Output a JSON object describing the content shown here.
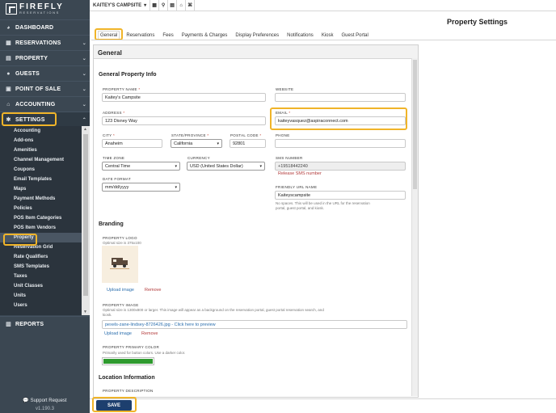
{
  "brand": {
    "name": "FIREFLY",
    "sub": "RESERVATIONS"
  },
  "sidebar": {
    "items": [
      {
        "label": "DASHBOARD",
        "icon": "dashboard-icon"
      },
      {
        "label": "RESERVATIONS",
        "icon": "calendar-icon"
      },
      {
        "label": "PROPERTY",
        "icon": "building-icon"
      },
      {
        "label": "GUESTS",
        "icon": "user-icon"
      },
      {
        "label": "POINT OF SALE",
        "icon": "register-icon"
      },
      {
        "label": "ACCOUNTING",
        "icon": "bank-icon"
      },
      {
        "label": "SETTINGS",
        "icon": "gear-icon"
      }
    ],
    "settings_sub": [
      "Accounting",
      "Add-ons",
      "Amenities",
      "Channel Management",
      "Coupons",
      "Email Templates",
      "Maps",
      "Payment Methods",
      "Policies",
      "POS Item Categories",
      "POS Item Vendors",
      "Property",
      "Reservation Grid",
      "Rate Qualifiers",
      "SMS Templates",
      "Taxes",
      "Unit Classes",
      "Units",
      "Users"
    ],
    "active_sub": "Property",
    "reports": "REPORTS",
    "support": "Support Request",
    "version": "v1.190.3"
  },
  "topbar": {
    "campsite": "KAITEY'S CAMPSITE"
  },
  "page": {
    "title": "Property Settings"
  },
  "tabs": [
    "General",
    "Reservations",
    "Fees",
    "Payments & Charges",
    "Display Preferences",
    "Notifications",
    "Kiosk",
    "Guest Portal"
  ],
  "active_tab": "General",
  "panel": {
    "title": "General",
    "info_title": "General Property Info",
    "property_name": {
      "label": "PROPERTY NAME",
      "value": "Kaitey's Campsite"
    },
    "website": {
      "label": "WEBSITE",
      "value": ""
    },
    "address": {
      "label": "ADDRESS",
      "value": "123 Disney Way"
    },
    "email": {
      "label": "EMAIL",
      "value": "kaiteyvasquez@aspiraconnect.com"
    },
    "city": {
      "label": "CITY",
      "value": "Anaheim"
    },
    "state": {
      "label": "STATE/PROVINCE",
      "value": "California"
    },
    "postal": {
      "label": "POSTAL CODE",
      "value": "92801"
    },
    "phone": {
      "label": "PHONE",
      "value": ""
    },
    "timezone": {
      "label": "TIME ZONE",
      "value": "Central Time"
    },
    "currency": {
      "label": "CURRENCY",
      "value": "USD (United States Dollar)"
    },
    "sms": {
      "label": "SMS NUMBER",
      "value": "+19518442240",
      "release": "Release SMS number"
    },
    "date_format": {
      "label": "DATE FORMAT",
      "value": "mm/dd/yyyy"
    },
    "friendly_url": {
      "label": "FRIENDLY URL NAME",
      "value": "Kaiteyscampsite",
      "hint_1": "No spaces. This will be used in the URL for the reservation",
      "hint_2": "portal, guest portal, and kiosk."
    },
    "branding_title": "Branding",
    "logo": {
      "label": "PROPERTY LOGO",
      "hint": "Optimal size is 375x100",
      "upload": "Upload image",
      "remove": "Remove"
    },
    "image": {
      "label": "PROPERTY IMAGE",
      "hint_1": "Optimal size is 1300x800 or larger. This image will appear as a background on the reservation portal, guest portal reservation search, and",
      "hint_2": "kiosk.",
      "file": "pexels-zane-lindsey-8726426.jpg - Click here to preview",
      "upload": "Upload image",
      "remove": "Remove"
    },
    "primary_color": {
      "label": "PROPERTY PRIMARY COLOR",
      "hint": "Primarily used for button colors. Use a darker color.",
      "value": "#2e9a2e"
    },
    "location_title": "Location Information",
    "description_label": "PROPERTY DESCRIPTION"
  },
  "save_label": "SAVE",
  "colors": {
    "sidebar": "#3b4752",
    "highlight": "#f0b429",
    "save": "#1d3f6e"
  }
}
